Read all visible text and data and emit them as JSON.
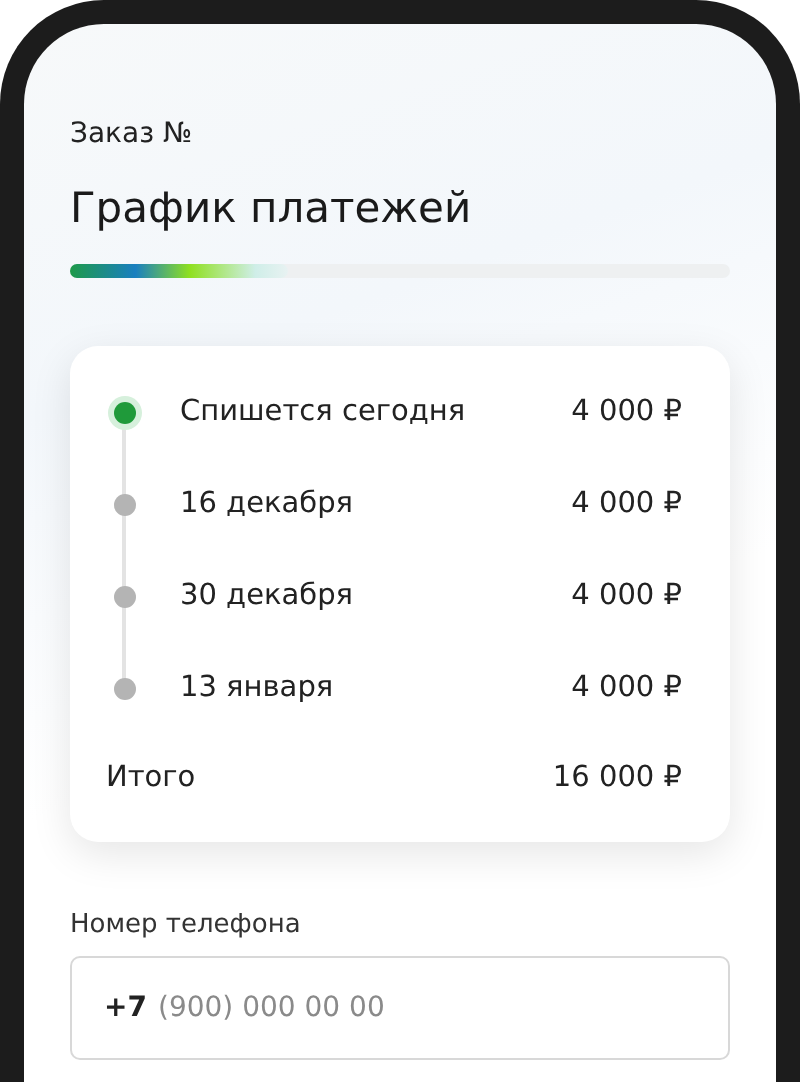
{
  "order_label": "Заказ №",
  "title": "График платежей",
  "progress": {
    "level": 0.33
  },
  "schedule": {
    "payments": [
      {
        "date": "Спишется сегодня",
        "amount": "4 000 ₽",
        "current": true
      },
      {
        "date": "16 декабря",
        "amount": "4 000 ₽",
        "current": false
      },
      {
        "date": "30 декабря",
        "amount": "4 000 ₽",
        "current": false
      },
      {
        "date": "13 января",
        "amount": "4 000 ₽",
        "current": false
      }
    ],
    "total": {
      "label": "Итого",
      "amount": "16 000 ₽"
    }
  },
  "phone_field": {
    "label": "Номер телефона",
    "prefix": "+7",
    "placeholder": "(900) 000 00 00"
  }
}
